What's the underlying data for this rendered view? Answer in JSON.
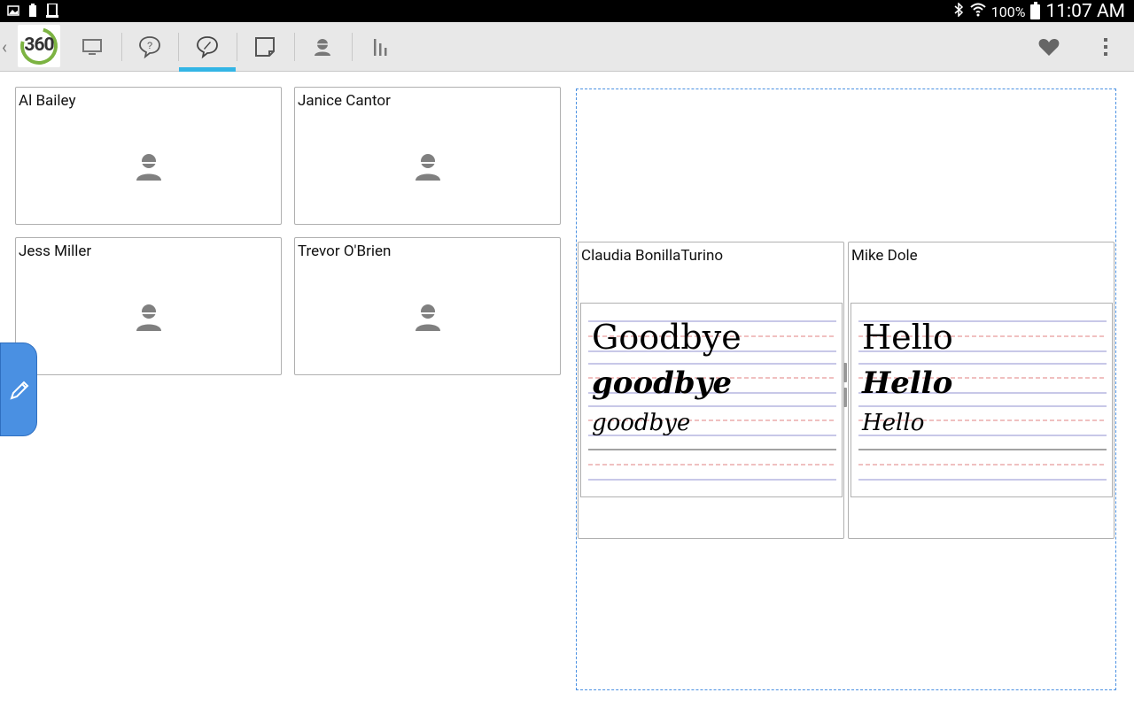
{
  "status": {
    "battery_pct": "100%",
    "time": "11:07 AM"
  },
  "toolbar": {
    "logo_text": "360",
    "icons": [
      "monitor-icon",
      "question-bubble-icon",
      "pen-bubble-icon",
      "note-icon",
      "student-icon",
      "bar-chart-icon"
    ],
    "active_tab": "pen-bubble-icon",
    "accent_color": "#33b5e5"
  },
  "students": [
    {
      "name": "Al Bailey"
    },
    {
      "name": "Janice Cantor"
    },
    {
      "name": "Jess Miller"
    },
    {
      "name": "Trevor O'Brien"
    }
  ],
  "compare": [
    {
      "name": "Claudia BonillaTurino",
      "lines": [
        "Goodbye",
        "goodbye",
        "goodbye"
      ]
    },
    {
      "name": "Mike Dole",
      "lines": [
        "Hello",
        "Hello",
        "Hello"
      ]
    }
  ]
}
